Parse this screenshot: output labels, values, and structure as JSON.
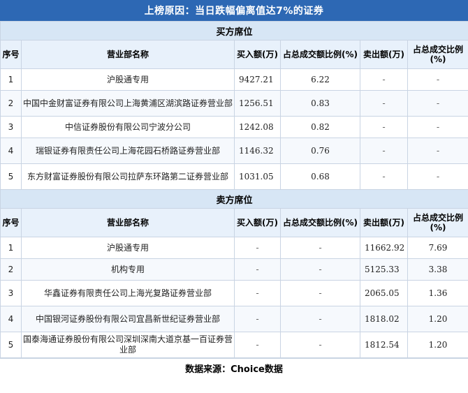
{
  "title": "上榜原因：当日跌幅偏离值达7%的证券",
  "headers": {
    "idx": "序号",
    "name": "营业部名称",
    "buy": "买入额(万)",
    "buy_pct": "占总成交额比例(%)",
    "sell": "卖出额(万)",
    "sell_pct": "占总成交比例(%)"
  },
  "buy_section": {
    "label": "买方席位",
    "rows": [
      {
        "idx": "1",
        "name": "沪股通专用",
        "buy": "9427.21",
        "buy_pct": "6.22",
        "sell": "-",
        "sell_pct": "-"
      },
      {
        "idx": "2",
        "name": "中国中金财富证券有限公司上海黄浦区湖滨路证券营业部",
        "buy": "1256.51",
        "buy_pct": "0.83",
        "sell": "-",
        "sell_pct": "-"
      },
      {
        "idx": "3",
        "name": "中信证券股份有限公司宁波分公司",
        "buy": "1242.08",
        "buy_pct": "0.82",
        "sell": "-",
        "sell_pct": "-"
      },
      {
        "idx": "4",
        "name": "瑞银证券有限责任公司上海花园石桥路证券营业部",
        "buy": "1146.32",
        "buy_pct": "0.76",
        "sell": "-",
        "sell_pct": "-"
      },
      {
        "idx": "5",
        "name": "东方财富证券股份有限公司拉萨东环路第二证券营业部",
        "buy": "1031.05",
        "buy_pct": "0.68",
        "sell": "-",
        "sell_pct": "-"
      }
    ]
  },
  "sell_section": {
    "label": "卖方席位",
    "rows": [
      {
        "idx": "1",
        "name": "沪股通专用",
        "buy": "-",
        "buy_pct": "-",
        "sell": "11662.92",
        "sell_pct": "7.69"
      },
      {
        "idx": "2",
        "name": "机构专用",
        "buy": "-",
        "buy_pct": "-",
        "sell": "5125.33",
        "sell_pct": "3.38"
      },
      {
        "idx": "3",
        "name": "华鑫证券有限责任公司上海光复路证券营业部",
        "buy": "-",
        "buy_pct": "-",
        "sell": "2065.05",
        "sell_pct": "1.36"
      },
      {
        "idx": "4",
        "name": "中国银河证券股份有限公司宜昌新世纪证券营业部",
        "buy": "-",
        "buy_pct": "-",
        "sell": "1818.02",
        "sell_pct": "1.20"
      },
      {
        "idx": "5",
        "name": "国泰海通证券股份有限公司深圳深南大道京基一百证券营业部",
        "buy": "-",
        "buy_pct": "-",
        "sell": "1812.54",
        "sell_pct": "1.20"
      }
    ]
  },
  "footer": "数据来源：Choice数据"
}
